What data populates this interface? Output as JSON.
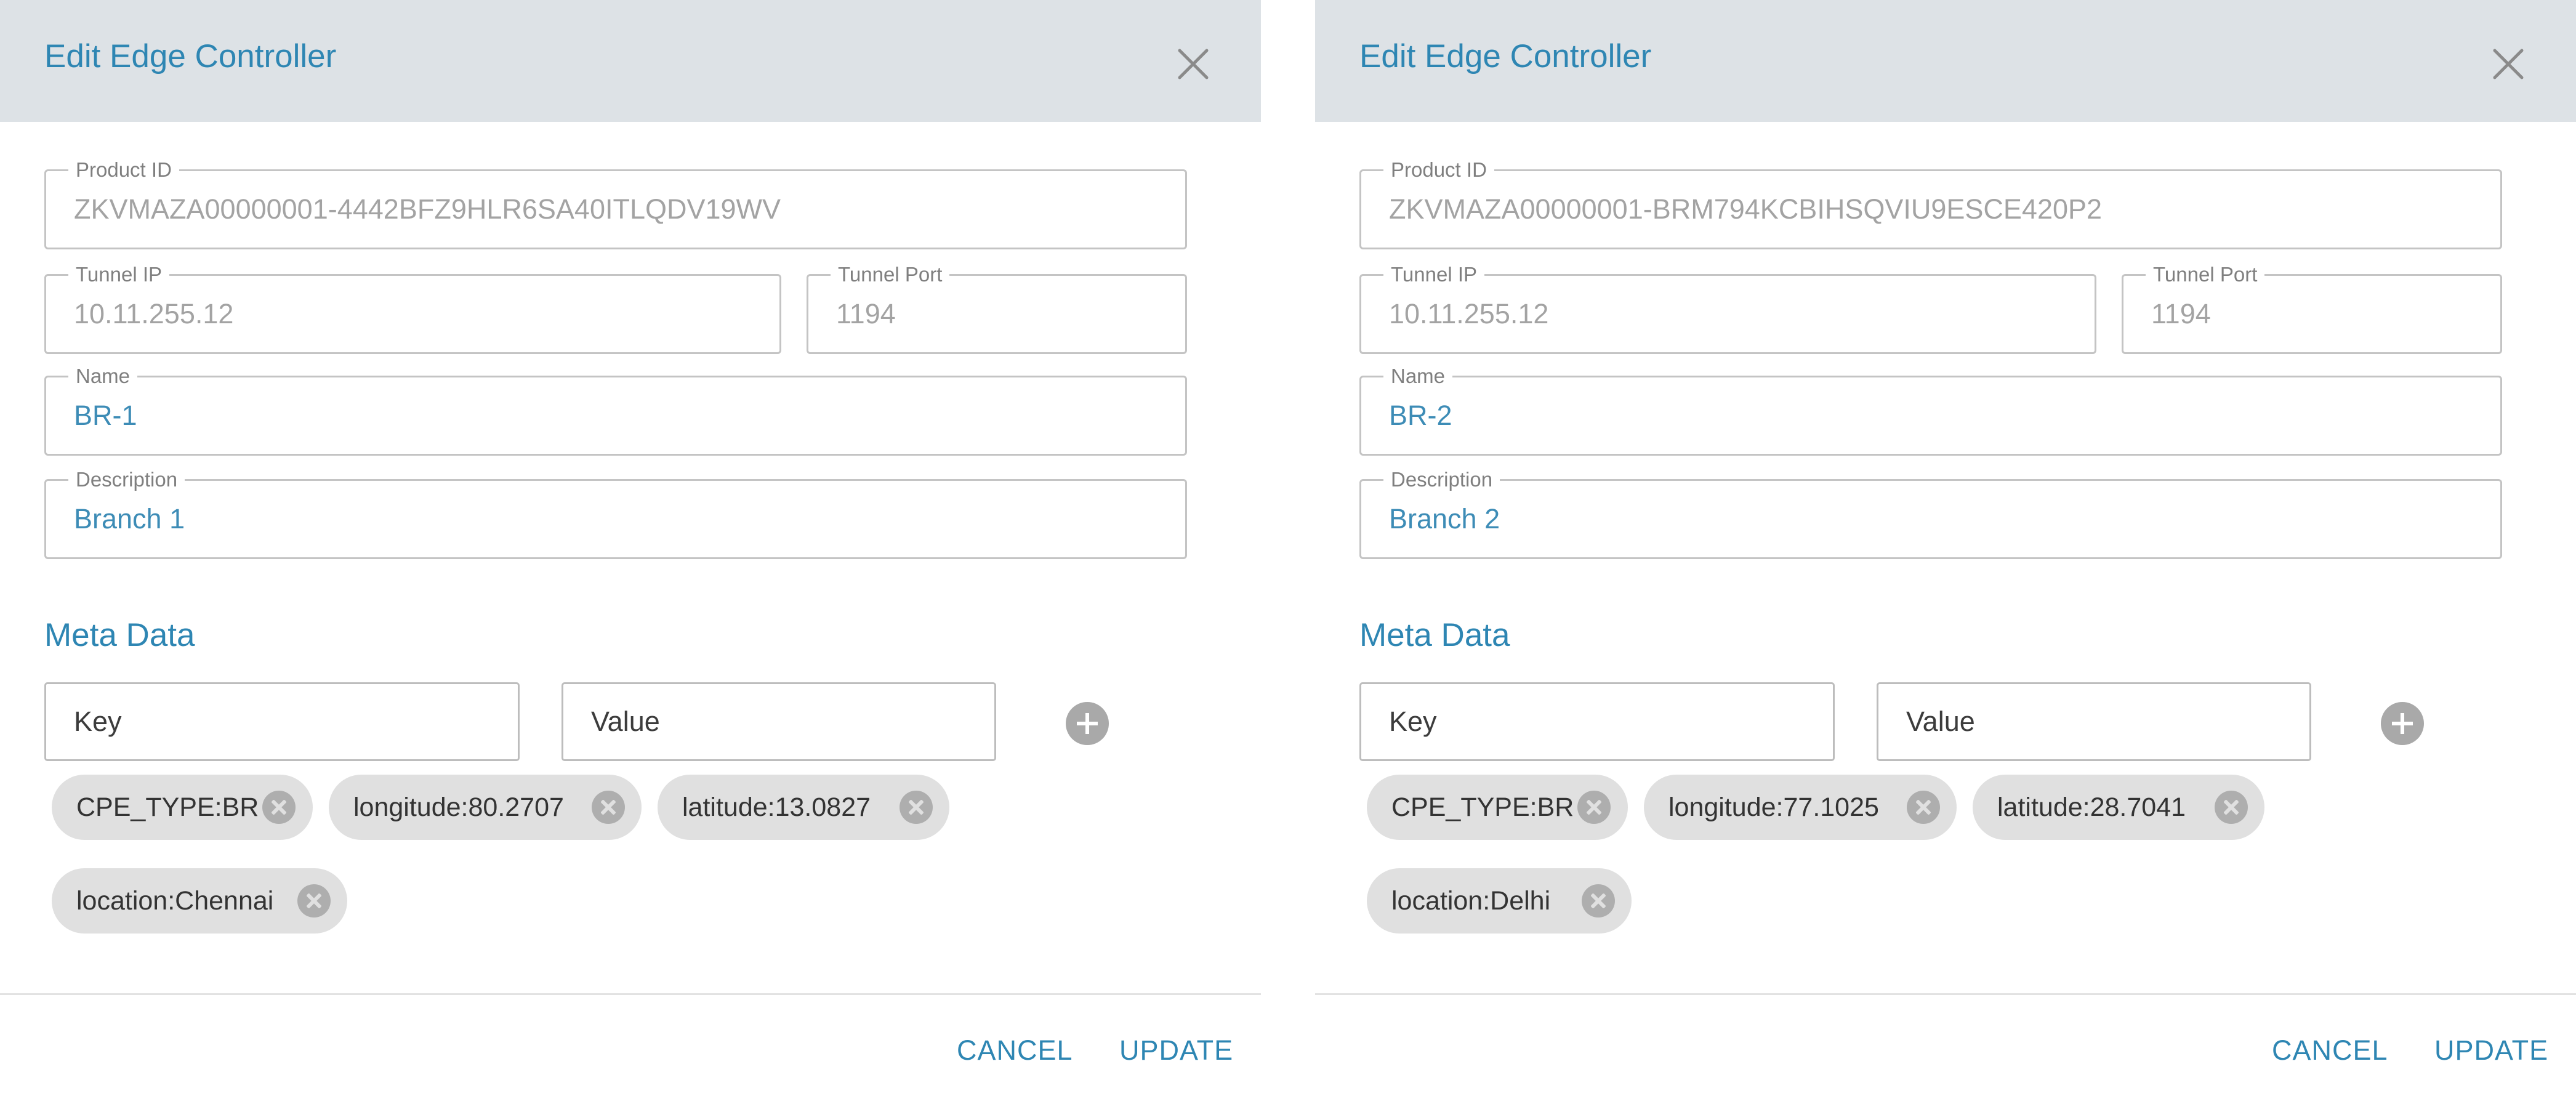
{
  "dialogs": [
    {
      "title": "Edit Edge Controller",
      "fields": {
        "product_id": {
          "label": "Product ID",
          "value": "ZKVMAZA00000001-4442BFZ9HLR6SA40ITLQDV19WV"
        },
        "tunnel_ip": {
          "label": "Tunnel IP",
          "value": "10.11.255.12"
        },
        "tunnel_port": {
          "label": "Tunnel Port",
          "value": "1194"
        },
        "name": {
          "label": "Name",
          "value": "BR-1"
        },
        "description": {
          "label": "Description",
          "value": "Branch 1"
        }
      },
      "meta_data": {
        "heading": "Meta Data",
        "key_placeholder": "Key",
        "value_placeholder": "Value",
        "chips": [
          "CPE_TYPE:BR",
          "longitude:80.2707",
          "latitude:13.0827",
          "location:Chennai"
        ]
      },
      "footer": {
        "cancel_label": "CANCEL",
        "update_label": "UPDATE"
      }
    },
    {
      "title": "Edit Edge Controller",
      "fields": {
        "product_id": {
          "label": "Product ID",
          "value": "ZKVMAZA00000001-BRM794KCBIHSQVIU9ESCE420P2"
        },
        "tunnel_ip": {
          "label": "Tunnel IP",
          "value": "10.11.255.12"
        },
        "tunnel_port": {
          "label": "Tunnel Port",
          "value": "1194"
        },
        "name": {
          "label": "Name",
          "value": "BR-2"
        },
        "description": {
          "label": "Description",
          "value": "Branch 2"
        }
      },
      "meta_data": {
        "heading": "Meta Data",
        "key_placeholder": "Key",
        "value_placeholder": "Value",
        "chips": [
          "CPE_TYPE:BR",
          "longitude:77.1025",
          "latitude:28.7041",
          "location:Delhi"
        ]
      },
      "footer": {
        "cancel_label": "CANCEL",
        "update_label": "UPDATE"
      }
    }
  ],
  "colors": {
    "header_bg": "#dde2e6",
    "accent": "#2e86b3",
    "editable_text": "#3d8cb6",
    "readonly_text": "#a3a3a3",
    "chip_bg": "#e0e0e0",
    "chip_remove": "#aeaeae",
    "field_border": "#c4c4c4"
  },
  "icons": {
    "close": "close-icon",
    "add": "add-circle-icon",
    "chip_remove": "cancel-circle-icon"
  }
}
